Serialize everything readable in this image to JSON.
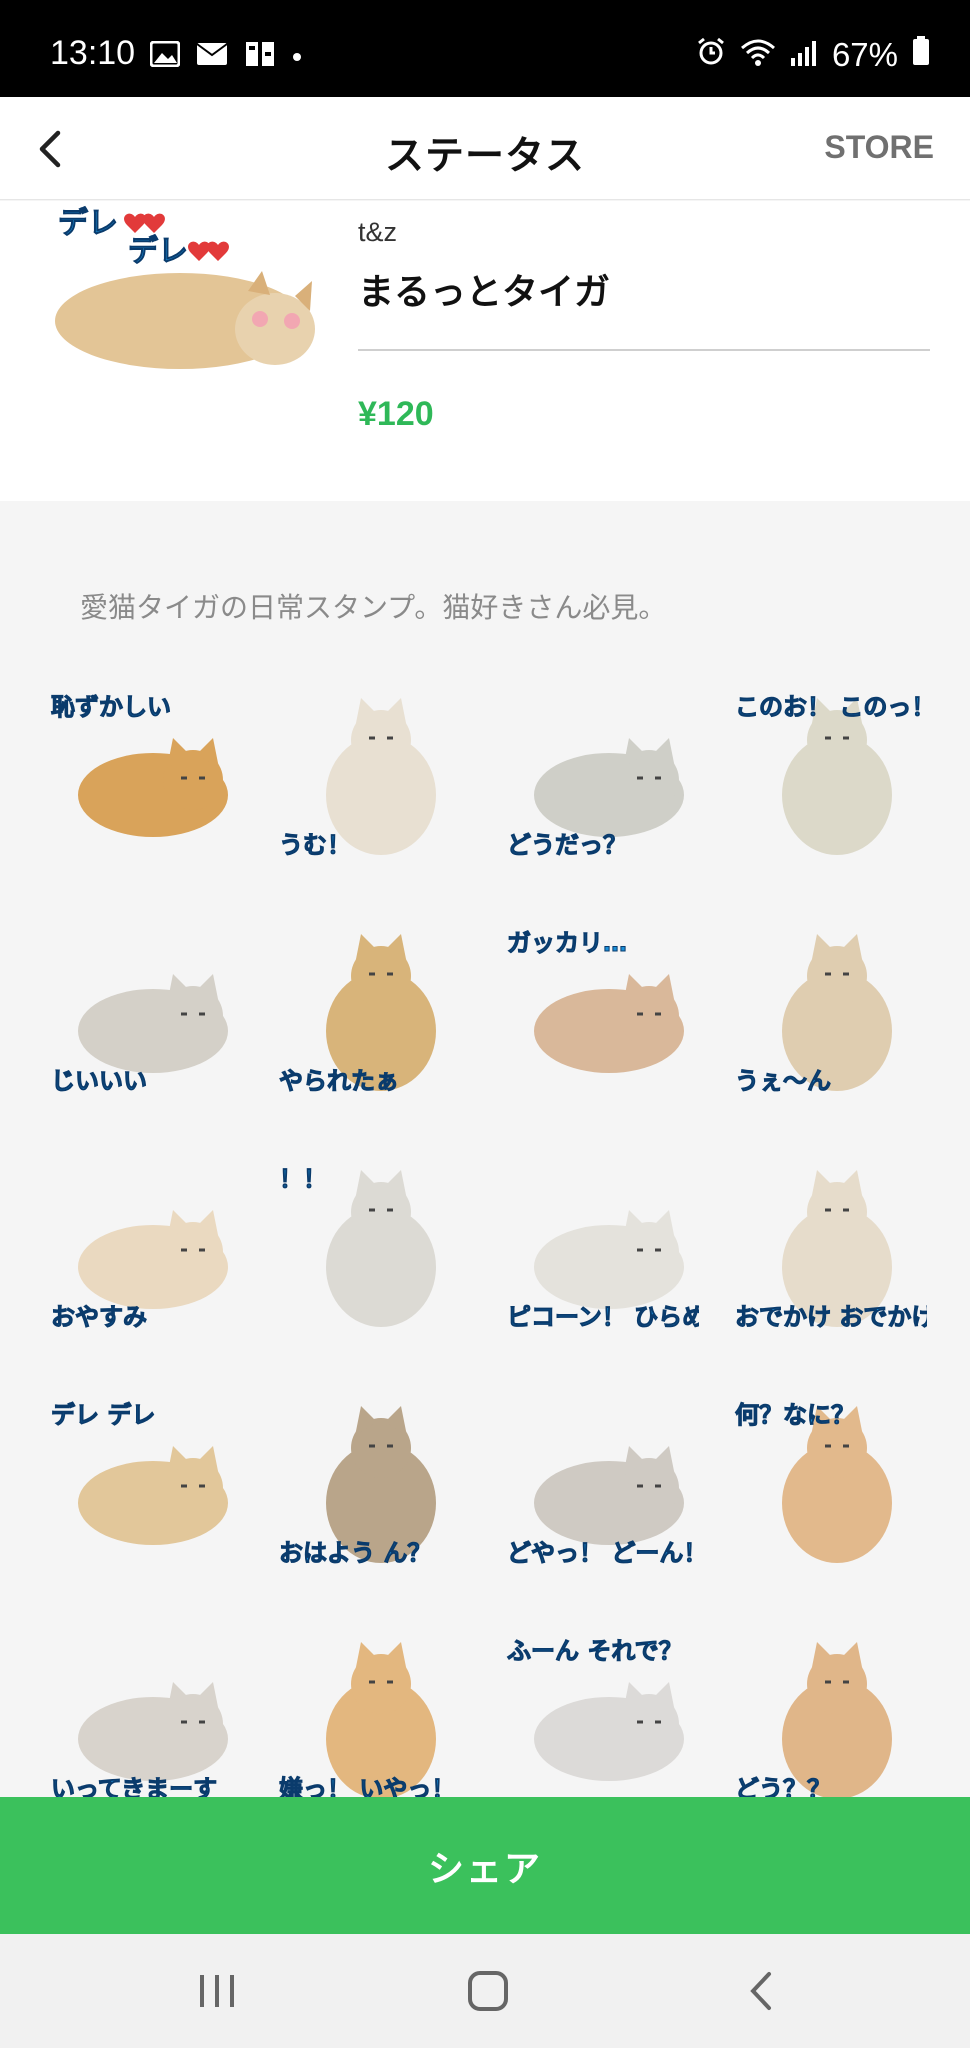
{
  "status_bar": {
    "time": "13:10",
    "battery": "67%"
  },
  "header": {
    "title": "ステータス",
    "store_label": "STORE"
  },
  "product": {
    "author": "t&z",
    "name": "まるっとタイガ",
    "price": "¥120",
    "main_sticker_text": [
      "デレ",
      "デレ"
    ]
  },
  "description": "愛猫タイガの日常スタンプ。猫好きさん必見。",
  "stickers": [
    {
      "text": "恥ずかしい",
      "fur": "#d9a35a",
      "icon": "sleeping-cat-icon"
    },
    {
      "text": "うむ！",
      "fur": "#e8e0d2",
      "icon": "standing-cat-icon"
    },
    {
      "text": "どうだっ？",
      "fur": "#cfcfc8",
      "icon": "sitting-cat-icon"
    },
    {
      "text": "このお！ このっ！",
      "fur": "#dcd9c9",
      "icon": "jumping-cat-icon"
    },
    {
      "text": "じいいい",
      "fur": "#d4d0c8",
      "icon": "staring-cat-icon"
    },
    {
      "text": "やられたぁ",
      "fur": "#d8b47a",
      "icon": "lying-cat-icon"
    },
    {
      "text": "ガッカリ…",
      "fur": "#d9b89a",
      "icon": "sad-cat-icon"
    },
    {
      "text": "うぇ～ん",
      "fur": "#dfcdb0",
      "icon": "crying-cat-icon"
    },
    {
      "text": "おやすみ",
      "fur": "#ead9c0",
      "icon": "sleeping-cat-icon"
    },
    {
      "text": "！！",
      "fur": "#dcdad4",
      "icon": "surprised-cat-icon"
    },
    {
      "text": "ピコーン！ ひらめいた",
      "fur": "#e4e2dc",
      "icon": "idea-cat-icon"
    },
    {
      "text": "おでかけ おでかけ",
      "fur": "#e6dccb",
      "icon": "walking-cat-icon"
    },
    {
      "text": "デレ デレ",
      "fur": "#e2c79a",
      "icon": "lying-cat-icon"
    },
    {
      "text": "おはよう ん？",
      "fur": "#b9a58a",
      "icon": "waking-cat-icon"
    },
    {
      "text": "どやっ！ どーん！",
      "fur": "#cfcac3",
      "icon": "paw-icon"
    },
    {
      "text": "何？なに？",
      "fur": "#e2b98c",
      "icon": "curious-cat-icon"
    },
    {
      "text": "いってきまーす",
      "fur": "#d8d3cc",
      "icon": "leaving-cat-icon"
    },
    {
      "text": "嫌っ！ いやっ！",
      "fur": "#e3b77f",
      "icon": "refusing-cat-icon"
    },
    {
      "text": "ふーん それで？",
      "fur": "#dcdad8",
      "icon": "unimpressed-cat-icon"
    },
    {
      "text": "どう？？",
      "fur": "#e0b689",
      "icon": "dressed-cat-icon"
    }
  ],
  "share_button": {
    "label": "シェア"
  },
  "colors": {
    "accent_green": "#3bc15c",
    "price_green": "#2fb858",
    "sticker_text": "#1a8fd8"
  }
}
